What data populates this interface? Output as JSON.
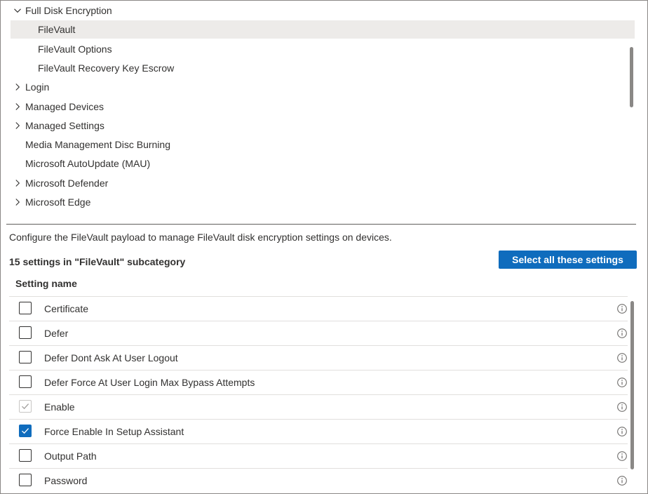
{
  "tree": {
    "items": [
      {
        "label": "Full Disk Encryption",
        "level": 0,
        "expander": "chevron-down-icon",
        "selected": false
      },
      {
        "label": "FileVault",
        "level": 1,
        "expander": "",
        "selected": true
      },
      {
        "label": "FileVault Options",
        "level": 1,
        "expander": "",
        "selected": false
      },
      {
        "label": "FileVault Recovery Key Escrow",
        "level": 1,
        "expander": "",
        "selected": false
      },
      {
        "label": "Login",
        "level": 0,
        "expander": "chevron-right-icon",
        "selected": false
      },
      {
        "label": "Managed Devices",
        "level": 0,
        "expander": "chevron-right-icon",
        "selected": false
      },
      {
        "label": "Managed Settings",
        "level": 0,
        "expander": "chevron-right-icon",
        "selected": false
      },
      {
        "label": "Media Management Disc Burning",
        "level": 0,
        "expander": "",
        "selected": false
      },
      {
        "label": "Microsoft AutoUpdate (MAU)",
        "level": 0,
        "expander": "",
        "selected": false
      },
      {
        "label": "Microsoft Defender",
        "level": 0,
        "expander": "chevron-right-icon",
        "selected": false
      },
      {
        "label": "Microsoft Edge",
        "level": 0,
        "expander": "chevron-right-icon",
        "selected": false
      }
    ]
  },
  "description": "Configure the FileVault payload to manage FileVault disk encryption settings on devices.",
  "count_label": "15 settings in \"FileVault\" subcategory",
  "select_all_label": "Select all these settings",
  "column_header": "Setting name",
  "settings": [
    {
      "name": "Certificate",
      "state": "unchecked"
    },
    {
      "name": "Defer",
      "state": "unchecked"
    },
    {
      "name": "Defer Dont Ask At User Logout",
      "state": "unchecked"
    },
    {
      "name": "Defer Force At User Login Max Bypass Attempts",
      "state": "unchecked"
    },
    {
      "name": "Enable",
      "state": "checked-disabled"
    },
    {
      "name": "Force Enable In Setup Assistant",
      "state": "checked"
    },
    {
      "name": "Output Path",
      "state": "unchecked"
    },
    {
      "name": "Password",
      "state": "unchecked"
    }
  ],
  "colors": {
    "accent": "#0f6cbd",
    "selected_row": "#edebe9",
    "text": "#323130"
  }
}
